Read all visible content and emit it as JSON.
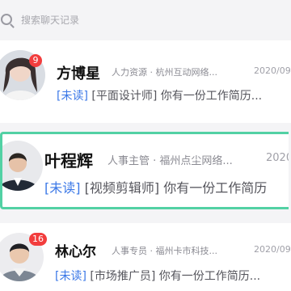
{
  "search": {
    "placeholder": "搜索聊天记录"
  },
  "conversations": [
    {
      "name": "方博星",
      "meta": "人力资源 · 杭州互动网络...",
      "date": "2020/09",
      "unread_tag": "[未读]",
      "job_tag": "[平面设计师]",
      "message": "你有一份工作简历...",
      "badge": "9"
    },
    {
      "name": "叶程辉",
      "meta": "人事主管 · 福州点尘网络...",
      "date": "2020/",
      "unread_tag": "[未读]",
      "job_tag": "[视频剪辑师]",
      "message": "你有一份工作简历",
      "badge": ""
    },
    {
      "name": "林心尔",
      "meta": "人事专员 · 福州卡市科技...",
      "date": "2020/09",
      "unread_tag": "[未读]",
      "job_tag": "[市场推广员]",
      "message": "你有一份工作简历...",
      "badge": "16"
    }
  ],
  "colors": {
    "accent_border": "#52d1a4",
    "unread": "#3b78e7",
    "badge": "#f23d3d"
  }
}
